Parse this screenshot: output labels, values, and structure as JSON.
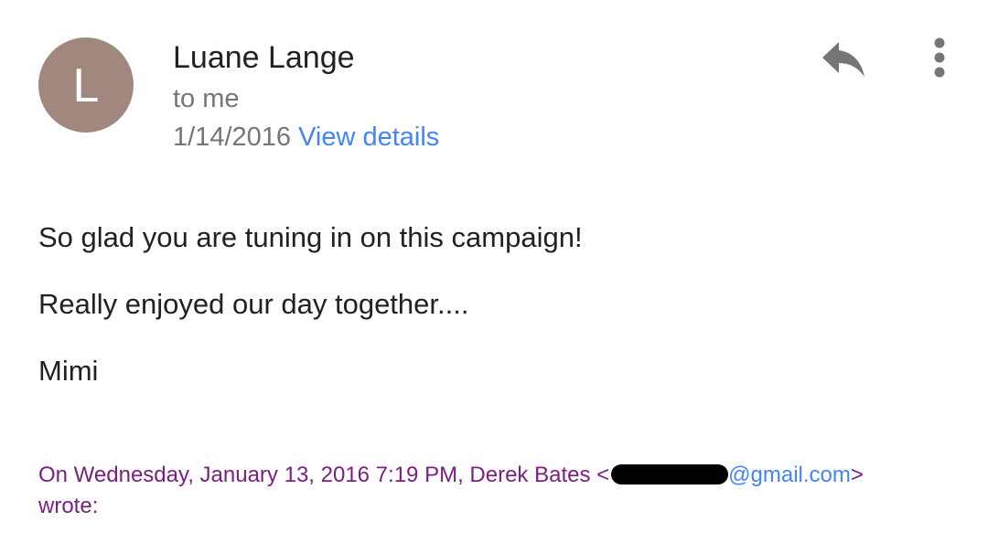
{
  "header": {
    "avatar_letter": "L",
    "avatar_color": "#a1887f",
    "sender_name": "Luane Lange",
    "recipient": "to me",
    "date": "1/14/2016",
    "view_details_label": "View details",
    "reply_icon": "reply-icon",
    "more_icon": "more-vert-icon"
  },
  "message": {
    "lines": [
      "So glad you are tuning in on this campaign!",
      "Really enjoyed our day together....",
      "Mimi"
    ]
  },
  "quote": {
    "attribution_prefix": "On Wednesday, January 13, 2016 7:19 PM, Derek Bates <",
    "email_domain": "@gmail.com",
    "attribution_suffix": ">",
    "wrote": "wrote:"
  },
  "colors": {
    "link": "#4285f4",
    "quote": "#7b1f82",
    "secondary_text": "#757575",
    "primary_text": "#212121"
  }
}
